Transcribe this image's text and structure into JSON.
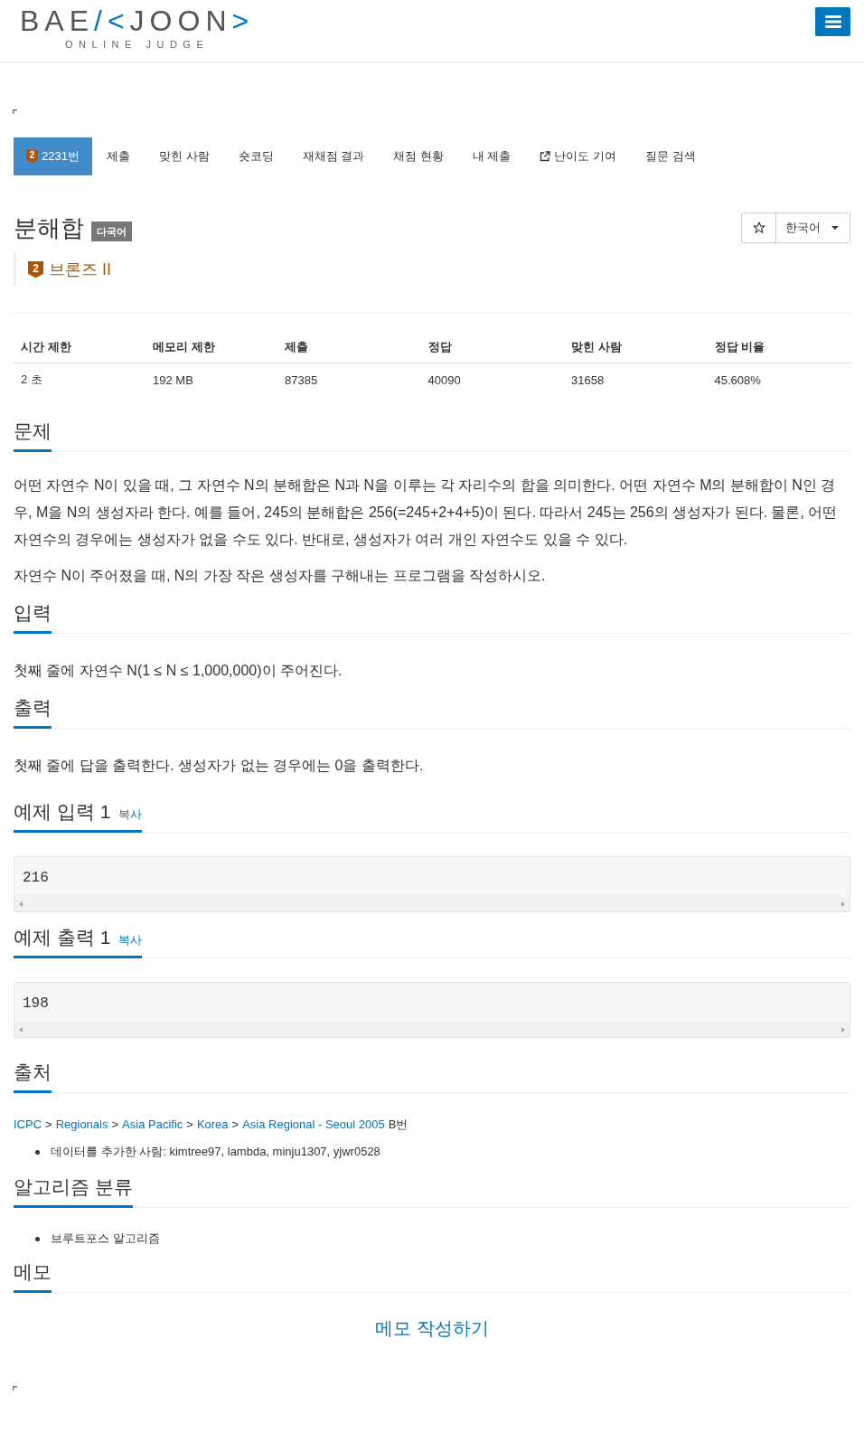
{
  "header": {
    "logo": [
      {
        "text": "BAE",
        "accent": false
      },
      {
        "text": "/<",
        "accent": true
      },
      {
        "text": "JOON",
        "accent": false
      },
      {
        "text": ">",
        "accent": true
      }
    ],
    "logo_subtitle": "ONLINE JUDGE"
  },
  "tabs": [
    {
      "kind": "problem",
      "badge": "2",
      "label": "2231번",
      "selected": true
    },
    {
      "kind": "plain",
      "label": "제출",
      "selected": false
    },
    {
      "kind": "plain",
      "label": "맞힌 사람",
      "selected": false
    },
    {
      "kind": "plain",
      "label": "숏코딩",
      "selected": false
    },
    {
      "kind": "plain",
      "label": "재채점 결과",
      "selected": false
    },
    {
      "kind": "plain",
      "label": "채점 현황",
      "selected": false
    },
    {
      "kind": "plain",
      "label": "내 제출",
      "selected": false
    },
    {
      "kind": "external",
      "label": "난이도 기여",
      "selected": false
    },
    {
      "kind": "plain",
      "label": "질문 검색",
      "selected": false
    }
  ],
  "problem": {
    "title": "분해합",
    "label": "다국어",
    "language": "한국어",
    "tier": {
      "badge": "2",
      "name": "브론즈 II"
    }
  },
  "limits": {
    "columns": [
      "시간 제한",
      "메모리 제한",
      "제출",
      "정답",
      "맞힌 사람",
      "정답 비율"
    ],
    "rows": [
      [
        "2 초",
        "192 MB",
        "87385",
        "40090",
        "31658",
        "45.608%"
      ]
    ]
  },
  "sections": [
    {
      "kind": "text",
      "title": "문제",
      "paragraphs": [
        "어떤 자연수 N이 있을 때, 그 자연수 N의 분해합은 N과 N을 이루는 각 자리수의 합을 의미한다. 어떤 자연수 M의 분해합이 N인 경우, M을 N의 생성자라 한다. 예를 들어, 245의 분해합은 256(=245+2+4+5)이 된다. 따라서 245는 256의 생성자가 된다. 물론, 어떤 자연수의 경우에는 생성자가 없을 수도 있다. 반대로, 생성자가 여러 개인 자연수도 있을 수 있다.",
        "자연수 N이 주어졌을 때, N의 가장 작은 생성자를 구해내는 프로그램을 작성하시오."
      ]
    },
    {
      "kind": "text",
      "title": "입력",
      "paragraphs": [
        "첫째 줄에 자연수 N(1 ≤ N ≤ 1,000,000)이 주어진다."
      ]
    },
    {
      "kind": "text",
      "title": "출력",
      "paragraphs": [
        "첫째 줄에 답을 출력한다. 생성자가 없는 경우에는 0을 출력한다."
      ]
    },
    {
      "kind": "sample",
      "title": "예제 입력 1",
      "copy": "복사",
      "content": "216"
    },
    {
      "kind": "sample",
      "title": "예제 출력 1",
      "copy": "복사",
      "content": "198"
    },
    {
      "kind": "source",
      "title": "출처",
      "crumbs": [
        {
          "kind": "link",
          "text": "ICPC"
        },
        {
          "kind": "separator",
          "text": ">"
        },
        {
          "kind": "link",
          "text": "Regionals"
        },
        {
          "kind": "separator",
          "text": ">"
        },
        {
          "kind": "link",
          "text": "Asia Pacific"
        },
        {
          "kind": "separator",
          "text": ">"
        },
        {
          "kind": "link",
          "text": "Korea"
        },
        {
          "kind": "separator",
          "text": ">"
        },
        {
          "kind": "link",
          "text": "Asia Regional - Seoul 2005"
        },
        {
          "kind": "suffix",
          "text": "B번"
        }
      ],
      "items": [
        "데이터를 추가한 사람: kimtree97, lambda, minju1307, yjwr0528"
      ]
    },
    {
      "kind": "list",
      "title": "알고리즘 분류",
      "items": [
        "브루트포스 알고리즘"
      ]
    },
    {
      "kind": "memo",
      "title": "메모",
      "link": "메모 작성하기"
    }
  ]
}
